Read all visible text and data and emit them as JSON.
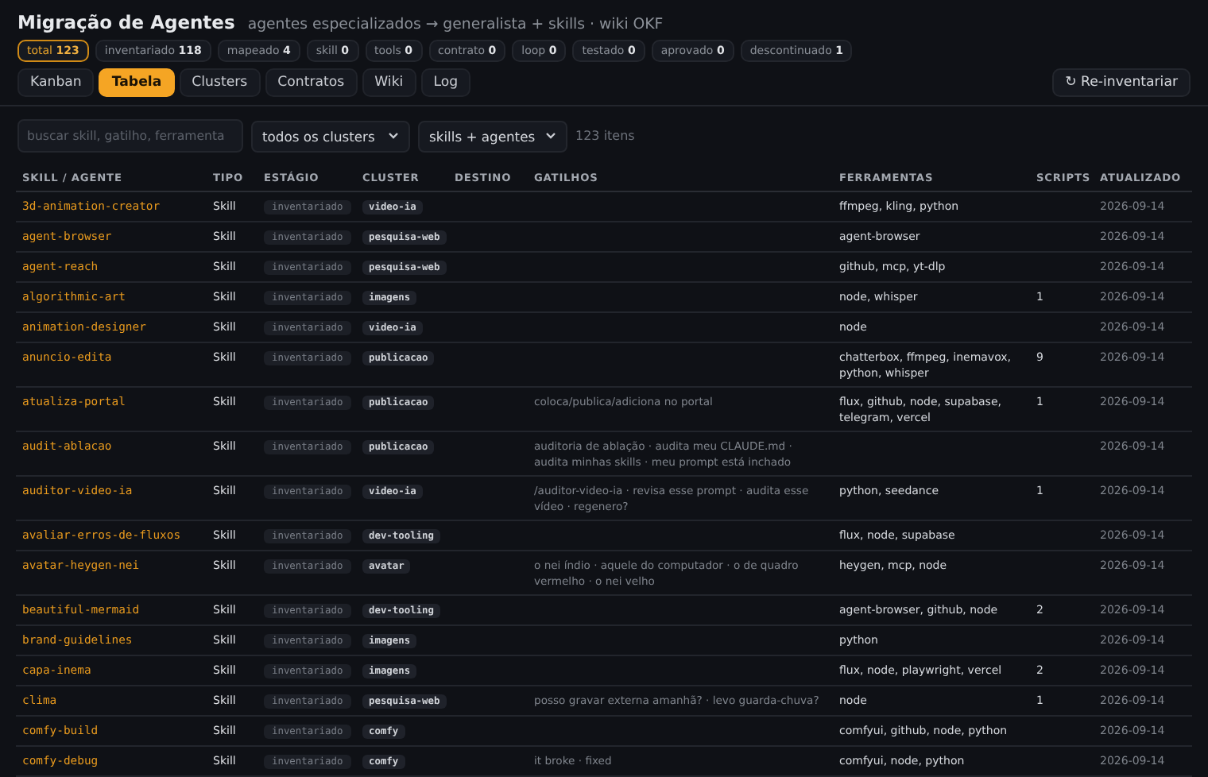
{
  "header": {
    "title": "Migração de Agentes",
    "subtitle": "agentes especializados → generalista + skills · wiki OKF"
  },
  "counters": [
    {
      "label": "total",
      "count": "123",
      "selected": true
    },
    {
      "label": "inventariado",
      "count": "118",
      "selected": false
    },
    {
      "label": "mapeado",
      "count": "4",
      "selected": false
    },
    {
      "label": "skill",
      "count": "0",
      "selected": false
    },
    {
      "label": "tools",
      "count": "0",
      "selected": false
    },
    {
      "label": "contrato",
      "count": "0",
      "selected": false
    },
    {
      "label": "loop",
      "count": "0",
      "selected": false
    },
    {
      "label": "testado",
      "count": "0",
      "selected": false
    },
    {
      "label": "aprovado",
      "count": "0",
      "selected": false
    },
    {
      "label": "descontinuado",
      "count": "1",
      "selected": false
    }
  ],
  "tabs": [
    {
      "label": "Kanban",
      "selected": false
    },
    {
      "label": "Tabela",
      "selected": true
    },
    {
      "label": "Clusters",
      "selected": false
    },
    {
      "label": "Contratos",
      "selected": false
    },
    {
      "label": "Wiki",
      "selected": false
    },
    {
      "label": "Log",
      "selected": false
    }
  ],
  "reinventory_button": {
    "icon": "↻",
    "label": "Re-inventariar"
  },
  "filters": {
    "search": {
      "placeholder": "buscar skill, gatilho, ferramenta"
    },
    "cluster_select": "todos os clusters",
    "type_select": "skills + agentes",
    "count": "123 itens"
  },
  "table": {
    "columns": [
      "SKILL / AGENTE",
      "TIPO",
      "ESTÁGIO",
      "CLUSTER",
      "DESTINO",
      "GATILHOS",
      "FERRAMENTAS",
      "SCRIPTS",
      "ATUALIZADO"
    ],
    "rows": [
      {
        "name": "3d-animation-creator",
        "type": "Skill",
        "stage": "inventariado",
        "cluster": "video-ia",
        "tools": "ffmpeg, kling, python",
        "updated": "2026-09-14"
      },
      {
        "name": "agent-browser",
        "type": "Skill",
        "stage": "inventariado",
        "cluster": "pesquisa-web",
        "tools": "agent-browser",
        "updated": "2026-09-14"
      },
      {
        "name": "agent-reach",
        "type": "Skill",
        "stage": "inventariado",
        "cluster": "pesquisa-web",
        "tools": "github, mcp, yt-dlp",
        "updated": "2026-09-14"
      },
      {
        "name": "algorithmic-art",
        "type": "Skill",
        "stage": "inventariado",
        "cluster": "imagens",
        "tools": "node, whisper",
        "scripts": "1",
        "updated": "2026-09-14"
      },
      {
        "name": "animation-designer",
        "type": "Skill",
        "stage": "inventariado",
        "cluster": "video-ia",
        "tools": "node",
        "updated": "2026-09-14"
      },
      {
        "name": "anuncio-edita",
        "type": "Skill",
        "stage": "inventariado",
        "cluster": "publicacao",
        "tools": "chatterbox, ffmpeg, inemavox, python, whisper",
        "scripts": "9",
        "updated": "2026-09-14"
      },
      {
        "name": "atualiza-portal",
        "type": "Skill",
        "stage": "inventariado",
        "cluster": "publicacao",
        "triggers": "coloca/publica/adiciona no portal",
        "tools": "flux, github, node, supabase, telegram, vercel",
        "scripts": "1",
        "updated": "2026-09-14"
      },
      {
        "name": "audit-ablacao",
        "type": "Skill",
        "stage": "inventariado",
        "cluster": "publicacao",
        "triggers": "auditoria de ablação · audita meu CLAUDE.md · audita minhas skills · meu prompt está inchado",
        "updated": "2026-09-14"
      },
      {
        "name": "auditor-video-ia",
        "type": "Skill",
        "stage": "inventariado",
        "cluster": "video-ia",
        "triggers": "/auditor-video-ia · revisa esse prompt · audita esse vídeo · regenero?",
        "tools": "python, seedance",
        "scripts": "1",
        "updated": "2026-09-14"
      },
      {
        "name": "avaliar-erros-de-fluxos",
        "type": "Skill",
        "stage": "inventariado",
        "cluster": "dev-tooling",
        "tools": "flux, node, supabase",
        "updated": "2026-09-14"
      },
      {
        "name": "avatar-heygen-nei",
        "type": "Skill",
        "stage": "inventariado",
        "cluster": "avatar",
        "triggers": "o nei índio · aquele do computador · o de quadro vermelho · o nei velho",
        "tools": "heygen, mcp, node",
        "updated": "2026-09-14"
      },
      {
        "name": "beautiful-mermaid",
        "type": "Skill",
        "stage": "inventariado",
        "cluster": "dev-tooling",
        "tools": "agent-browser, github, node",
        "scripts": "2",
        "updated": "2026-09-14"
      },
      {
        "name": "brand-guidelines",
        "type": "Skill",
        "stage": "inventariado",
        "cluster": "imagens",
        "tools": "python",
        "updated": "2026-09-14"
      },
      {
        "name": "capa-inema",
        "type": "Skill",
        "stage": "inventariado",
        "cluster": "imagens",
        "tools": "flux, node, playwright, vercel",
        "scripts": "2",
        "updated": "2026-09-14"
      },
      {
        "name": "clima",
        "type": "Skill",
        "stage": "inventariado",
        "cluster": "pesquisa-web",
        "triggers": "posso gravar externa amanhã? · levo guarda-chuva?",
        "tools": "node",
        "scripts": "1",
        "updated": "2026-09-14"
      },
      {
        "name": "comfy-build",
        "type": "Skill",
        "stage": "inventariado",
        "cluster": "comfy",
        "tools": "comfyui, github, node, python",
        "updated": "2026-09-14"
      },
      {
        "name": "comfy-debug",
        "type": "Skill",
        "stage": "inventariado",
        "cluster": "comfy",
        "triggers": "it broke · fixed",
        "tools": "comfyui, node, python",
        "updated": "2026-09-14"
      }
    ]
  }
}
